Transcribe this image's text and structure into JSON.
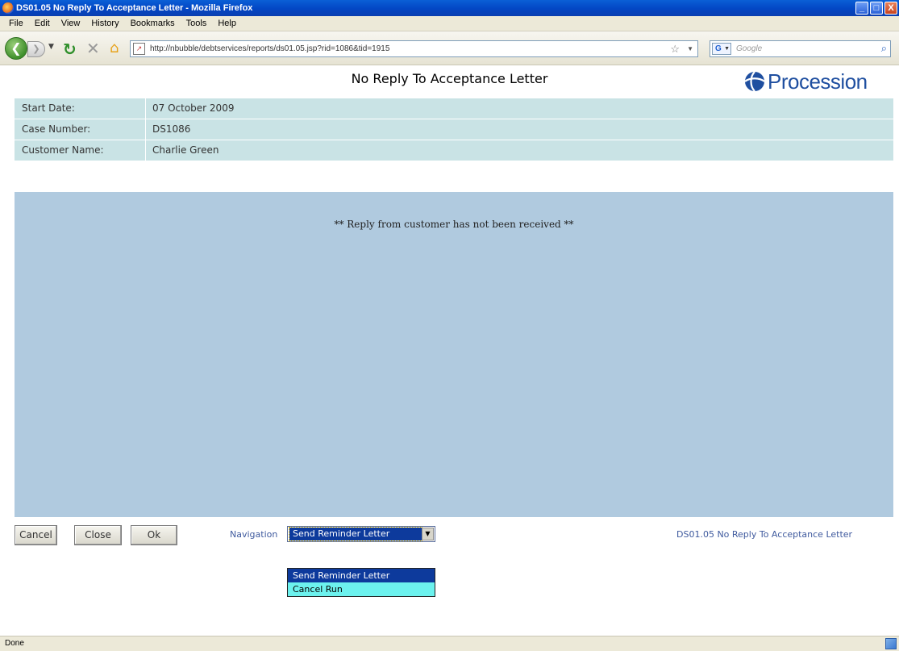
{
  "window": {
    "title": "DS01.05 No Reply To Acceptance Letter - Mozilla Firefox",
    "controls": [
      "_",
      "□",
      "X"
    ]
  },
  "menu": [
    "File",
    "Edit",
    "View",
    "History",
    "Bookmarks",
    "Tools",
    "Help"
  ],
  "toolbar": {
    "url": "http://nbubble/debtservices/reports/ds01.05.jsp?rid=1086&tid=1915",
    "search_placeholder": "Google",
    "search_engine": "G"
  },
  "page": {
    "title": "No Reply To Acceptance Letter",
    "logo_text": "Procession"
  },
  "info": {
    "start_date_label": "Start Date:",
    "start_date_value": "07 October 2009",
    "case_number_label": "Case Number:",
    "case_number_value": "DS1086",
    "customer_name_label": "Customer Name:",
    "customer_name_value": "Charlie Green"
  },
  "main": {
    "message": "** Reply from customer has not been received **"
  },
  "controls": {
    "cancel_label": "Cancel",
    "close_label": "Close",
    "ok_label": "Ok",
    "navigation_label": "Navigation",
    "navigation_selected": "Send Reminder Letter",
    "navigation_options": [
      "Send Reminder Letter",
      "Cancel Run"
    ],
    "report_id": "DS01.05 No Reply To Acceptance Letter"
  },
  "status": {
    "text": "Done"
  },
  "colors": {
    "info_row_bg": "#c9e3e5",
    "main_panel_bg": "#b0cadf",
    "link_blue": "#3f5a9e",
    "dropdown_bg": "#6cf2ee",
    "selection_bg": "#0d3a9c"
  }
}
